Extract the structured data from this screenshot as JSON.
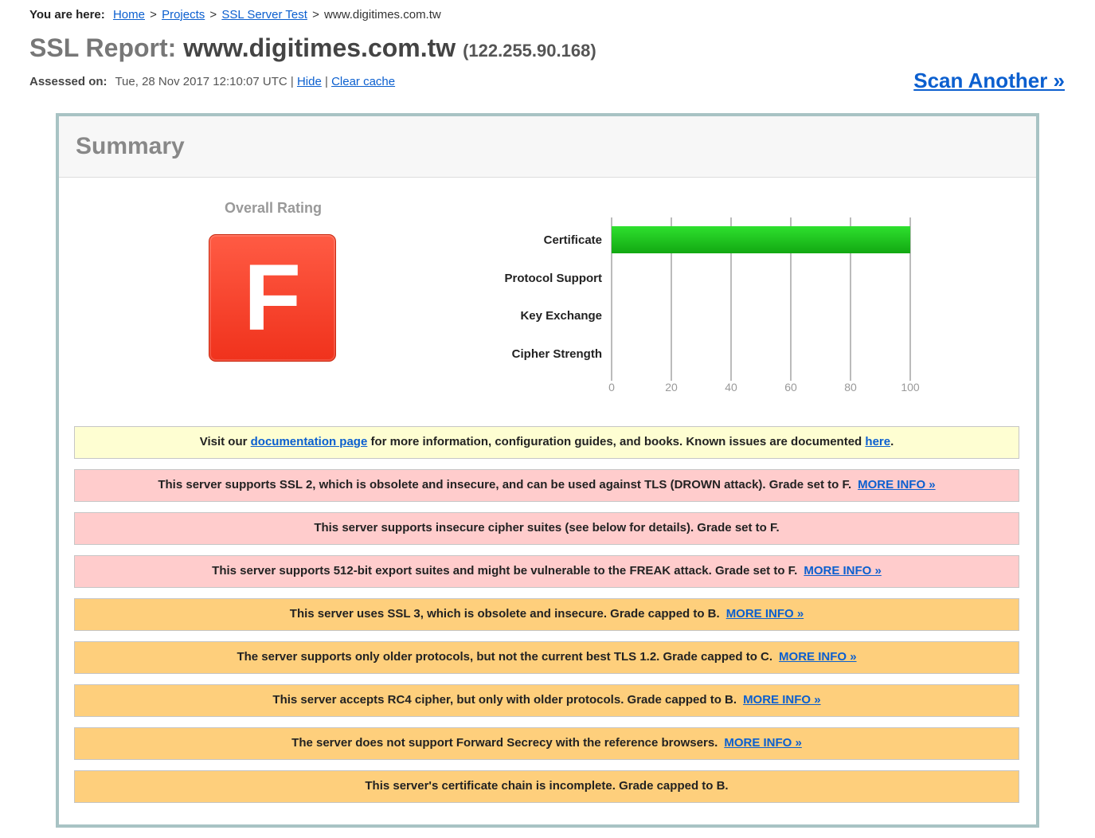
{
  "breadcrumb": {
    "label": "You are here:",
    "items": [
      "Home",
      "Projects",
      "SSL Server Test"
    ],
    "current": "www.digitimes.com.tw"
  },
  "report": {
    "prefix": "SSL Report:",
    "host": "www.digitimes.com.tw",
    "ip": "(122.255.90.168)"
  },
  "assessed": {
    "label": "Assessed on:",
    "date": "Tue, 28 Nov 2017 12:10:07 UTC",
    "hide": "Hide",
    "clear_cache": "Clear cache"
  },
  "scan_another": "Scan Another »",
  "summary": {
    "title": "Summary",
    "overall_label": "Overall Rating",
    "grade": "F",
    "grade_color": "#f0321c"
  },
  "chart_data": {
    "type": "bar",
    "orientation": "horizontal",
    "categories": [
      "Certificate",
      "Protocol Support",
      "Key Exchange",
      "Cipher Strength"
    ],
    "values": [
      100,
      0,
      0,
      0
    ],
    "xlim": [
      0,
      100
    ],
    "ticks": [
      0,
      20,
      40,
      60,
      80,
      100
    ],
    "bar_color": "#1ec51e",
    "grid": true
  },
  "notices": [
    {
      "type": "info",
      "before": "Visit our ",
      "link": "documentation page",
      "middle": " for more information, configuration guides, and books. Known issues are documented ",
      "link2": "here",
      "after": "."
    },
    {
      "type": "danger",
      "text": "This server supports SSL 2, which is obsolete and insecure, and can be used against TLS (DROWN attack). Grade set to F.",
      "more": "MORE INFO »"
    },
    {
      "type": "danger",
      "text": "This server supports insecure cipher suites (see below for details). Grade set to F.",
      "more": ""
    },
    {
      "type": "danger",
      "text": "This server supports 512-bit export suites and might be vulnerable to the FREAK attack. Grade set to F.",
      "more": "MORE INFO »"
    },
    {
      "type": "warn",
      "text": "This server uses SSL 3, which is obsolete and insecure. Grade capped to B.",
      "more": "MORE INFO »"
    },
    {
      "type": "warn",
      "text": "The server supports only older protocols, but not the current best TLS 1.2. Grade capped to C.",
      "more": "MORE INFO »"
    },
    {
      "type": "warn",
      "text": "This server accepts RC4 cipher, but only with older protocols. Grade capped to B.",
      "more": "MORE INFO »"
    },
    {
      "type": "warn",
      "text": "The server does not support Forward Secrecy with the reference browsers.",
      "more": "MORE INFO »"
    },
    {
      "type": "warn",
      "text": "This server's certificate chain is incomplete. Grade capped to B.",
      "more": ""
    }
  ]
}
